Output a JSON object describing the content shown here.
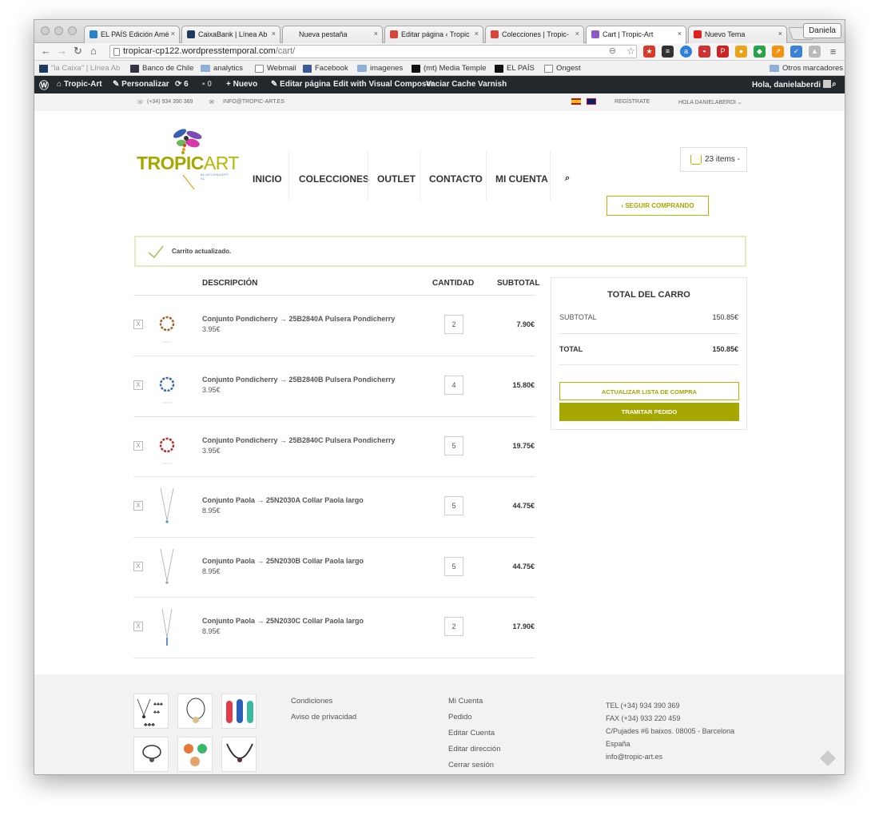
{
  "browser": {
    "user": "Daniela",
    "tabs": [
      {
        "title": "EL PAÍS Edición Amé"
      },
      {
        "title": "CaixaBank | Línea Ab"
      },
      {
        "title": "Nueva pestaña"
      },
      {
        "title": "Editar página ‹ Tropic"
      },
      {
        "title": "Colecciones | Tropic-"
      },
      {
        "title": "Cart | Tropic-Art"
      },
      {
        "title": "Nuevo Tema"
      }
    ],
    "url_host": "tropicar-cp122.wordpresstemporal.com",
    "url_path": "/cart/",
    "bookmarks": [
      "\"la Caixa\" | Línea Ab",
      "Banco de Chile",
      "analytics",
      "Webmail",
      "Facebook",
      "imagenes",
      "(mt) Media Temple",
      "EL PAÍS",
      "Ongest"
    ],
    "other_bookmarks": "Otros marcadores"
  },
  "wp_admin": {
    "site": "Tropic-Art",
    "customize": "Personalizar",
    "updates": "6",
    "comments": "0",
    "new": "Nuevo",
    "edit_page": "Editar página",
    "visual_composer": "Edit with Visual Composer",
    "varnish": "Vaciar Cache Varnish",
    "greeting": "Hola, danielaberdi"
  },
  "topbar": {
    "phone": "(+34) 934 390 369",
    "email": "INFO@TROPIC-ART.ES",
    "register": "REGÍSTRATE",
    "user": "HOLA DANIELABERDI"
  },
  "header": {
    "logo_main": "TROPIC",
    "logo_art": "ART",
    "logo_sub": "BLUECONCEPT SL",
    "nav": [
      "INICIO",
      "COLECCIONES",
      "OUTLET",
      "CONTACTO",
      "MI CUENTA"
    ],
    "cart_label": "23 items -"
  },
  "cart": {
    "continue_btn": "SEGUIR COMPRANDO",
    "notice": "Carrito actualizado.",
    "col_desc": "DESCRIPCIÓN",
    "col_qty": "CANTIDAD",
    "col_sub": "SUBTOTAL",
    "remove": "X",
    "items": [
      {
        "name": "Conjunto Pondicherry → 25B2840A Pulsera Pondicherry",
        "price": "3.95€",
        "qty": "2",
        "subtotal": "7.90€"
      },
      {
        "name": "Conjunto Pondicherry → 25B2840B Pulsera Pondicherry",
        "price": "3.95€",
        "qty": "4",
        "subtotal": "15.80€"
      },
      {
        "name": "Conjunto Pondicherry → 25B2840C Pulsera Pondicherry",
        "price": "3.95€",
        "qty": "5",
        "subtotal": "19.75€"
      },
      {
        "name": "Conjunto Paola → 25N2030A Collar Paola largo",
        "price": "8.95€",
        "qty": "5",
        "subtotal": "44.75€"
      },
      {
        "name": "Conjunto Paola → 25N2030B Collar Paola largo",
        "price": "8.95€",
        "qty": "5",
        "subtotal": "44.75€"
      },
      {
        "name": "Conjunto Paola → 25N2030C Collar Paola largo",
        "price": "8.95€",
        "qty": "2",
        "subtotal": "17.90€"
      }
    ]
  },
  "totals": {
    "title": "TOTAL DEL CARRO",
    "subtotal_label": "SUBTOTAL",
    "subtotal": "150.85€",
    "total_label": "TOTAL",
    "total": "150.85€",
    "update_btn": "ACTUALIZAR LISTA DE COMPRA",
    "checkout_btn": "TRAMITAR PEDIDO"
  },
  "footer": {
    "links1": [
      "Condiciones",
      "Aviso de privacidad"
    ],
    "links2": [
      "Mi Cuenta",
      "Pedido",
      "Editar Cuenta",
      "Editar dirección",
      "Cerrar sesión"
    ],
    "contact": [
      "TEL (+34) 934 390 369",
      "FAX (+34) 933 220 459",
      "C/Pujades #6 baixos. 08005 - Barcelona",
      "España",
      "info@tropic-art.es"
    ]
  },
  "colors": {
    "accent": "#a4a800",
    "dark": "#23282d",
    "notice_border": "#e1ecc3"
  }
}
